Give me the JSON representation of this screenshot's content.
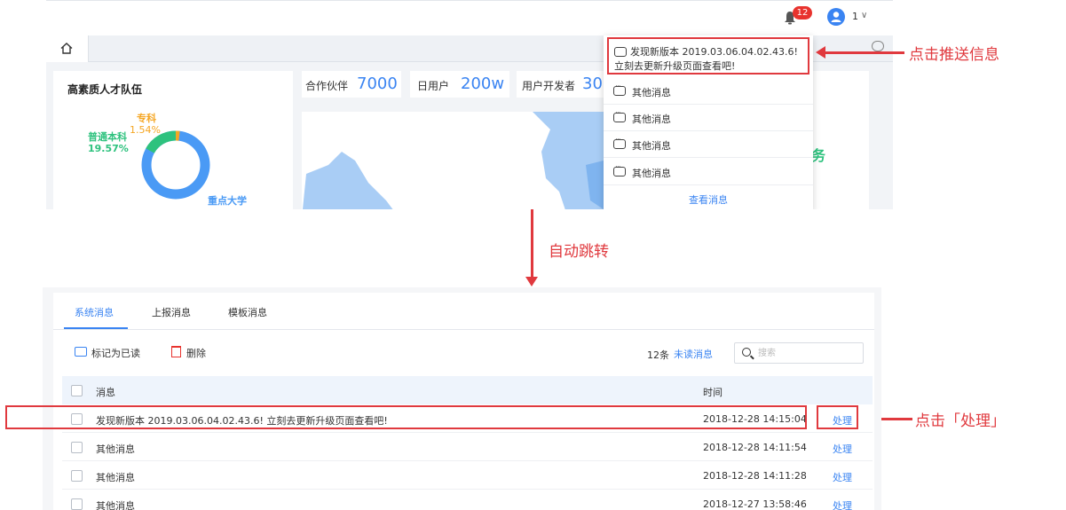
{
  "top": {
    "notification_count": "12",
    "user_name": "1",
    "user_caret": "∨",
    "left_card_title": "高素质人才队伍",
    "donut_labels": [
      {
        "name": "专科",
        "value": "1.54%"
      },
      {
        "name": "普通本科",
        "value": "19.57%"
      },
      {
        "name": "重点大学",
        "value": ""
      }
    ],
    "stats": [
      {
        "label": "合作伙伴",
        "value": "7000"
      },
      {
        "label": "日用户",
        "value": "200w"
      },
      {
        "label": "用户开发者",
        "value": "30"
      }
    ],
    "right_char": "务",
    "dropdown": {
      "first_line1": "发现新版本 2019.03.06.04.02.43.6!",
      "first_line2": "立刻去更新升级页面查看吧!",
      "items": [
        "其他消息",
        "其他消息",
        "其他消息",
        "其他消息"
      ],
      "view_label": "查看消息"
    }
  },
  "annotations": {
    "click_push": "点击推送信息",
    "auto_jump": "自动跳转",
    "click_handle": "点击「处理」"
  },
  "bottom": {
    "tabs": [
      "系统消息",
      "上报消息",
      "模板消息"
    ],
    "mark_read": "标记为已读",
    "delete": "删除",
    "count": "12条",
    "unread": "未读消息",
    "search_placeholder": "搜索",
    "col_message": "消息",
    "col_time": "时间",
    "rows": [
      {
        "message": "发现新版本 2019.03.06.04.02.43.6!  立刻去更新升级页面查看吧!",
        "time": "2018-12-28 14:15:04",
        "action": "处理"
      },
      {
        "message": "其他消息",
        "time": "2018-12-28 14:11:54",
        "action": "处理"
      },
      {
        "message": "其他消息",
        "time": "2018-12-28 14:11:28",
        "action": "处理"
      },
      {
        "message": "其他消息",
        "time": "2018-12-27 13:58:46",
        "action": "处理"
      }
    ]
  },
  "colors": {
    "accent": "#3a84f2",
    "annotation": "#e0393e",
    "badge": "#e8332e",
    "donut_main": "#4a9af5",
    "donut_green": "#2ec27e",
    "donut_orange": "#f5a623"
  }
}
